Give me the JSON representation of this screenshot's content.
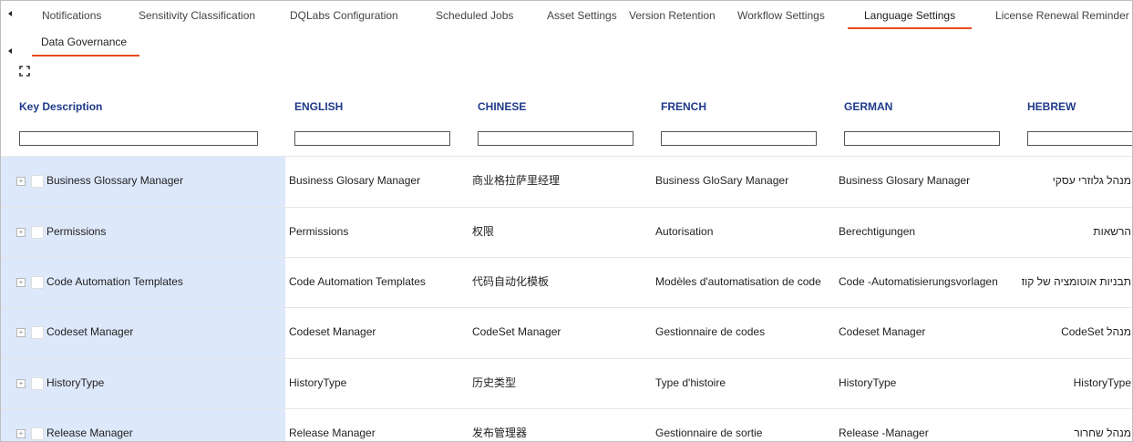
{
  "tabs_row1": [
    {
      "label": "Notifications"
    },
    {
      "label": "Sensitivity Classification"
    },
    {
      "label": "DQLabs Configuration"
    },
    {
      "label": "Scheduled Jobs"
    },
    {
      "label": "Asset Settings"
    },
    {
      "label": "Version Retention"
    },
    {
      "label": "Workflow Settings"
    },
    {
      "label": "Language Settings"
    },
    {
      "label": "License Renewal Reminder"
    }
  ],
  "tabs_row2": [
    {
      "label": "Data Governance"
    }
  ],
  "active_tab": "Language Settings",
  "columns": [
    "Key Description",
    "ENGLISH",
    "CHINESE",
    "FRENCH",
    "GERMAN",
    "HEBREW"
  ],
  "filters": [
    "",
    "",
    "",
    "",
    "",
    ""
  ],
  "rows": [
    {
      "key": "Business Glossary Manager",
      "english": "Business Glosary Manager",
      "chinese": "商业格拉萨里经理",
      "french": "Business GloSary Manager",
      "german": "Business Glosary Manager",
      "hebrew": "מנהל גלוזרי עסקי"
    },
    {
      "key": "Permissions",
      "english": "Permissions",
      "chinese": "权限",
      "french": "Autorisation",
      "german": "Berechtigungen",
      "hebrew": "הרשאות"
    },
    {
      "key": "Code Automation Templates",
      "english": "Code Automation Templates",
      "chinese": "代码自动化模板",
      "french": "Modèles d'automatisation de code",
      "german": "Code -Automatisierungsvorlagen",
      "hebrew": "תבניות אוטומציה של קוד"
    },
    {
      "key": "Codeset Manager",
      "english": "Codeset Manager",
      "chinese": "CodeSet Manager",
      "french": "Gestionnaire de codes",
      "german": "Codeset Manager",
      "hebrew": "מנהל CodeSet"
    },
    {
      "key": "HistoryType",
      "english": "HistoryType",
      "chinese": "历史类型",
      "french": "Type d'histoire",
      "german": "HistoryType",
      "hebrew": "HistoryType"
    },
    {
      "key": "Release Manager",
      "english": "Release Manager",
      "chinese": "发布管理器",
      "french": "Gestionnaire de sortie",
      "german": "Release -Manager",
      "hebrew": "מנהל שחרור"
    }
  ],
  "colors": {
    "accent": "#e8491d",
    "header_text": "#1f3a8a",
    "key_column_bg": "#dde8fb"
  }
}
